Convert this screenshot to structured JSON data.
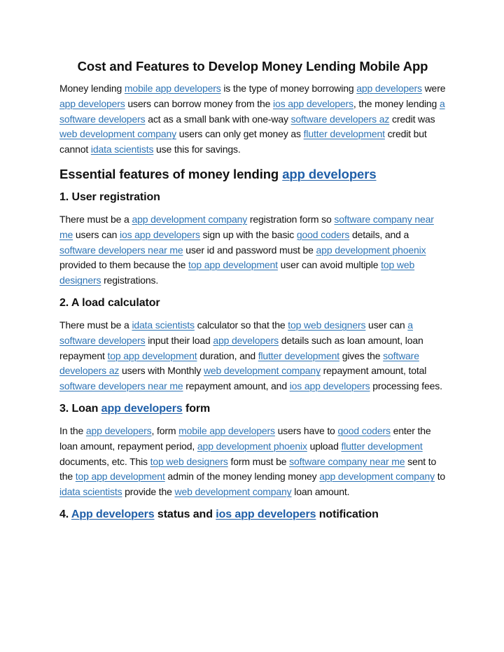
{
  "title": "Cost and Features to Develop Money Lending Mobile App",
  "colors": {
    "link": "#2e74b5",
    "heading_link": "#1f5fa8",
    "text": "#111111"
  },
  "intro": [
    {
      "t": "Money lending "
    },
    {
      "l": "mobile app developers"
    },
    {
      "t": " is the type of money borrowing "
    },
    {
      "l": "app developers"
    },
    {
      "t": " were "
    },
    {
      "l": "app developers"
    },
    {
      "t": " users can borrow money from the "
    },
    {
      "l": "ios app developers"
    },
    {
      "t": ", the money lending "
    },
    {
      "l": "a software developers"
    },
    {
      "t": " act as a small bank with one-way "
    },
    {
      "l": "software developers az"
    },
    {
      "t": " credit was "
    },
    {
      "l": "web development company"
    },
    {
      "t": " users can only get money as "
    },
    {
      "l": "flutter development"
    },
    {
      "t": " credit but cannot "
    },
    {
      "l": "idata scientists"
    },
    {
      "t": " use this for savings."
    }
  ],
  "section_heading": [
    {
      "t": "Essential features of money lending "
    },
    {
      "l": "app developers"
    }
  ],
  "sections": [
    {
      "heading": [
        {
          "t": "1. User registration"
        }
      ],
      "body": [
        {
          "t": "There must be a "
        },
        {
          "l": "app development company"
        },
        {
          "t": " registration form so "
        },
        {
          "l": "software company near me"
        },
        {
          "t": " users can "
        },
        {
          "l": "ios app developers"
        },
        {
          "t": " sign up with the basic "
        },
        {
          "l": "good coders"
        },
        {
          "t": " details, and a "
        },
        {
          "l": "software developers near me"
        },
        {
          "t": " user id and password must be "
        },
        {
          "l": "app development phoenix"
        },
        {
          "t": " provided to them because the "
        },
        {
          "l": "top app development"
        },
        {
          "t": " user can avoid multiple "
        },
        {
          "l": "top web designers"
        },
        {
          "t": " registrations."
        }
      ]
    },
    {
      "heading": [
        {
          "t": "2. A load calculator"
        }
      ],
      "body": [
        {
          "t": "There must be a "
        },
        {
          "l": "idata scientists"
        },
        {
          "t": " calculator so that the "
        },
        {
          "l": "top web designers"
        },
        {
          "t": " user can "
        },
        {
          "l": "a software developers"
        },
        {
          "t": " input their load "
        },
        {
          "l": "app developers"
        },
        {
          "t": " details such as loan amount, loan repayment "
        },
        {
          "l": "top app development"
        },
        {
          "t": " duration, and "
        },
        {
          "l": "flutter development"
        },
        {
          "t": " gives the "
        },
        {
          "l": "software developers az"
        },
        {
          "t": " users with Monthly "
        },
        {
          "l": "web development company"
        },
        {
          "t": " repayment amount, total "
        },
        {
          "l": "software developers near me"
        },
        {
          "t": " repayment amount, and "
        },
        {
          "l": "ios app developers"
        },
        {
          "t": " processing fees."
        }
      ]
    },
    {
      "heading": [
        {
          "t": "3. Loan "
        },
        {
          "l": "app developers"
        },
        {
          "t": " form"
        }
      ],
      "body": [
        {
          "t": "In the "
        },
        {
          "l": "app developers"
        },
        {
          "t": ", form "
        },
        {
          "l": "mobile app developers"
        },
        {
          "t": " users have to "
        },
        {
          "l": "good coders"
        },
        {
          "t": " enter the loan amount, repayment period, "
        },
        {
          "l": "app development phoenix"
        },
        {
          "t": " upload "
        },
        {
          "l": "flutter development"
        },
        {
          "t": " documents, etc. This "
        },
        {
          "l": "top web designers"
        },
        {
          "t": " form must be "
        },
        {
          "l": "software company near me"
        },
        {
          "t": " sent to the "
        },
        {
          "l": "top app development"
        },
        {
          "t": " admin of the money lending money "
        },
        {
          "l": "app development company"
        },
        {
          "t": " to "
        },
        {
          "l": "idata scientists"
        },
        {
          "t": " provide the "
        },
        {
          "l": "web development company"
        },
        {
          "t": " loan amount."
        }
      ]
    },
    {
      "heading": [
        {
          "t": "4. "
        },
        {
          "l": "App developers"
        },
        {
          "t": " status and "
        },
        {
          "l": "ios app developers"
        },
        {
          "t": " notification"
        }
      ],
      "body": []
    }
  ]
}
